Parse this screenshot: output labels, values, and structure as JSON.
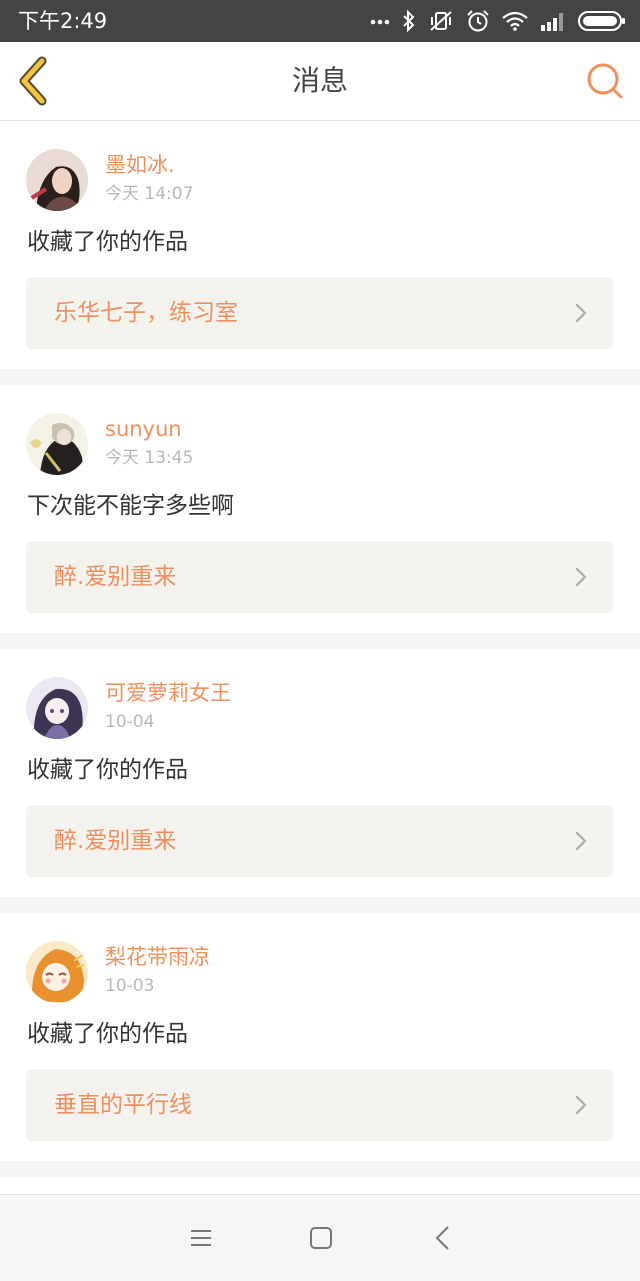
{
  "status_bar": {
    "time": "下午2:49",
    "icons": [
      "more-dots-icon",
      "bluetooth-icon",
      "vibrate-off-icon",
      "alarm-icon",
      "wifi-icon",
      "signal-icon",
      "battery-icon"
    ]
  },
  "header": {
    "title": "消息",
    "back_icon": "back-chevron-icon",
    "search_icon": "search-icon"
  },
  "messages": [
    {
      "username": "墨如冰.",
      "time": "今天 14:07",
      "text": "收藏了你的作品",
      "work_title": "乐华七子，练习室"
    },
    {
      "username": "sunyun",
      "time": "今天 13:45",
      "text": "下次能不能字多些啊",
      "work_title": "醉.爱别重来"
    },
    {
      "username": "可爱萝莉女王",
      "time": "10-04",
      "text": "收藏了你的作品",
      "work_title": "醉.爱别重来"
    },
    {
      "username": "梨花带雨凉",
      "time": "10-03",
      "text": "收藏了你的作品",
      "work_title": "垂直的平行线"
    }
  ],
  "system_nav": {
    "icons": [
      "menu-icon",
      "home-icon",
      "back-icon"
    ]
  },
  "colors": {
    "accent": "#f0905a",
    "status_bar": "#444444",
    "card_link_bg": "#f3f2ec"
  }
}
